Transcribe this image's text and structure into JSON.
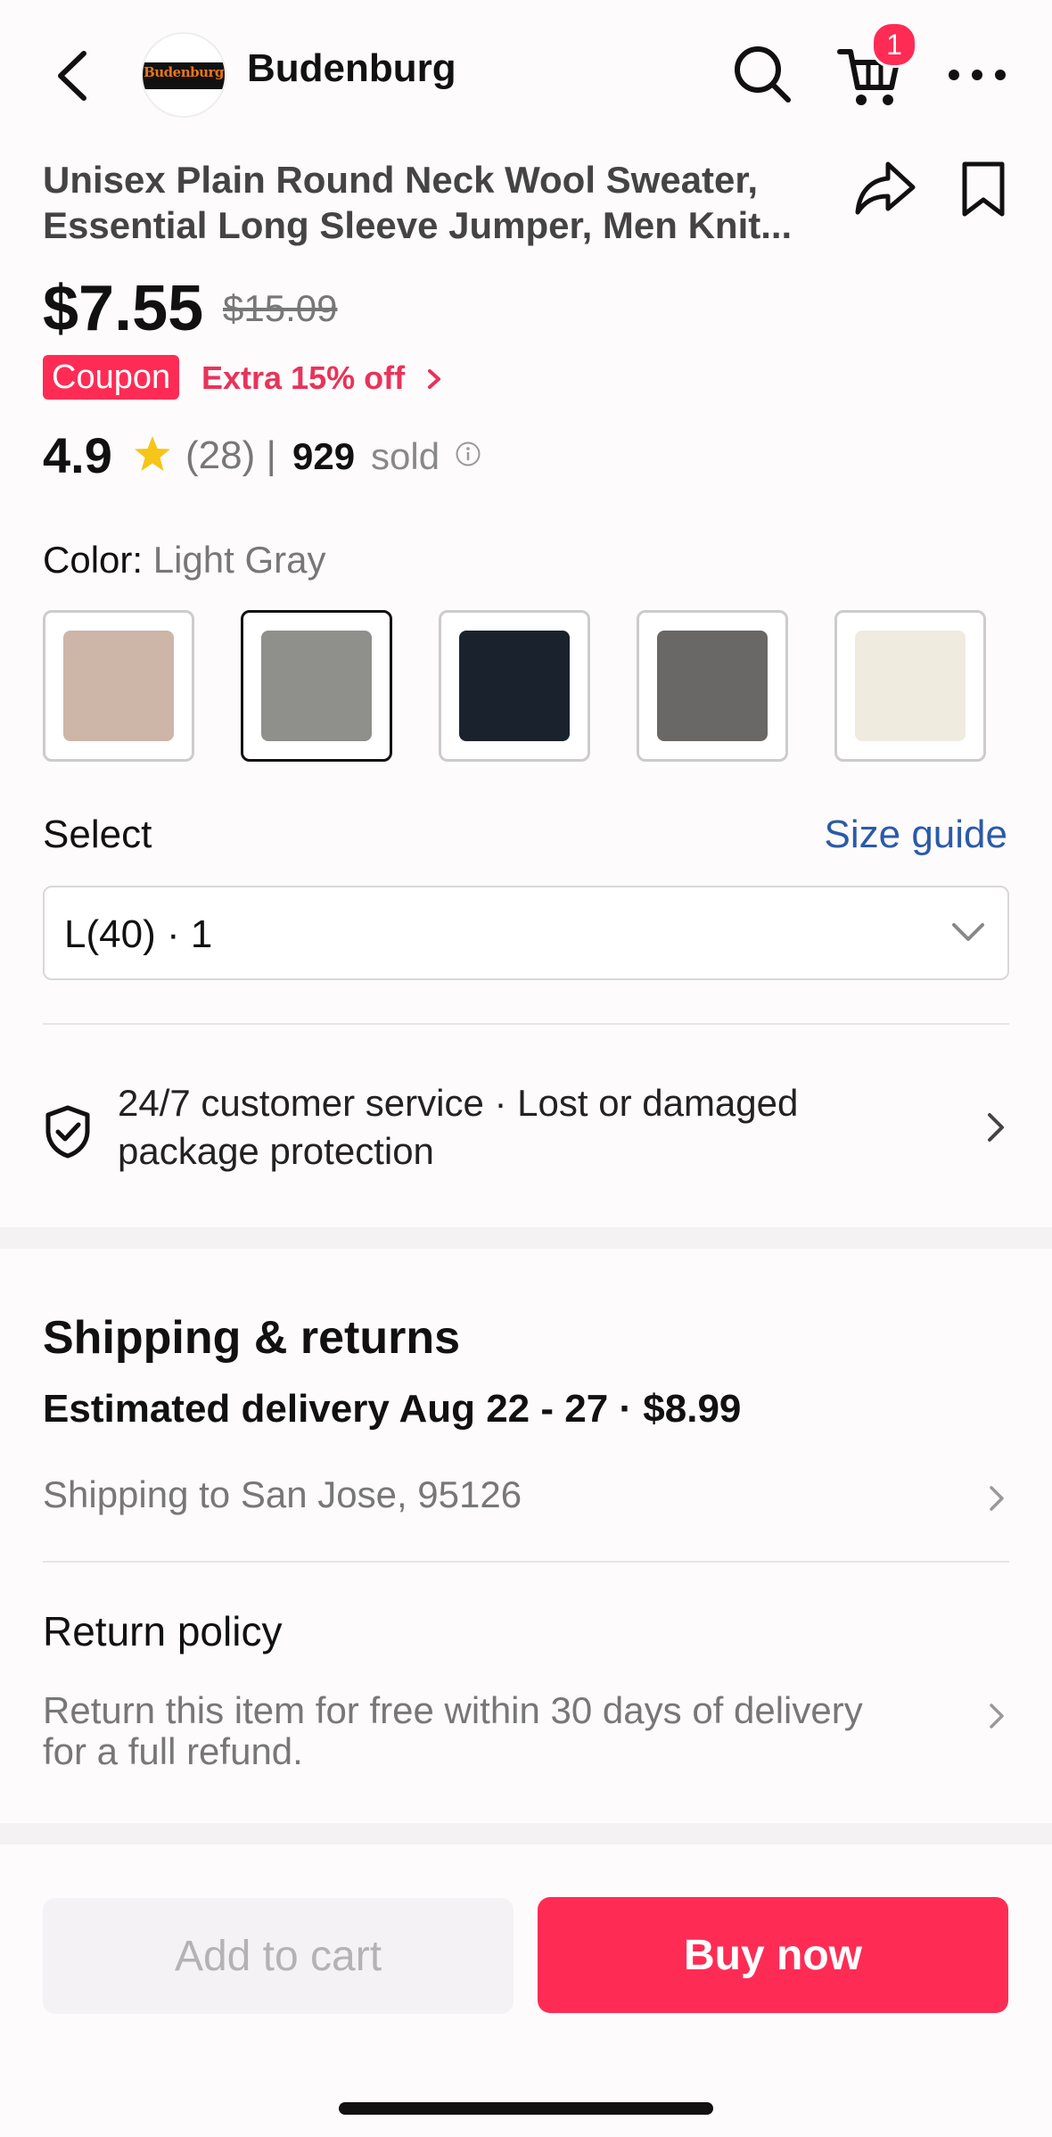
{
  "header": {
    "store_name": "Budenburg",
    "logo_text": "Budenburg",
    "cart_count": "1",
    "icons": [
      "chevron-left-icon",
      "search-icon",
      "cart-icon",
      "more-icon"
    ]
  },
  "product": {
    "title_line1": "Unisex Plain Round Neck Wool Sweater,",
    "title_line2": "Essential Long Sleeve Jumper, Men Knit...",
    "price": "$7.55",
    "original_price": "$15.09",
    "coupon_badge": "Coupon",
    "coupon_text": "Extra 15% off",
    "rating": "4.9",
    "reviews": "(28) |",
    "sold_count": "929",
    "sold_label": "sold"
  },
  "color": {
    "label": "Color:",
    "selected": "Light Gray",
    "swatches": [
      {
        "name": "Pink Beige",
        "color": "#cdb5a8"
      },
      {
        "name": "Light Gray",
        "color": "#8f8f8b"
      },
      {
        "name": "Navy",
        "color": "#1a232d"
      },
      {
        "name": "Dark Gray",
        "color": "#6a6866"
      },
      {
        "name": "Cream",
        "color": "#efebdf"
      }
    ]
  },
  "size": {
    "label": "Select",
    "guide": "Size guide",
    "selected": "L(40) · 1"
  },
  "service": {
    "line1": "24/7 customer service · Lost or damaged",
    "line2": "package protection"
  },
  "shipping": {
    "heading": "Shipping & returns",
    "delivery": "Estimated delivery Aug 22 - 27 · $8.99",
    "ship_to": "Shipping to San Jose, 95126",
    "return_title": "Return policy",
    "return_line1": "Return this item for free within 30 days of delivery",
    "return_line2": "for a full refund."
  },
  "actions": {
    "add_to_cart": "Add to cart",
    "buy_now": "Buy now"
  },
  "colors": {
    "accent": "#fe2c55",
    "link": "#2b5aa8",
    "star": "#f5c518"
  }
}
